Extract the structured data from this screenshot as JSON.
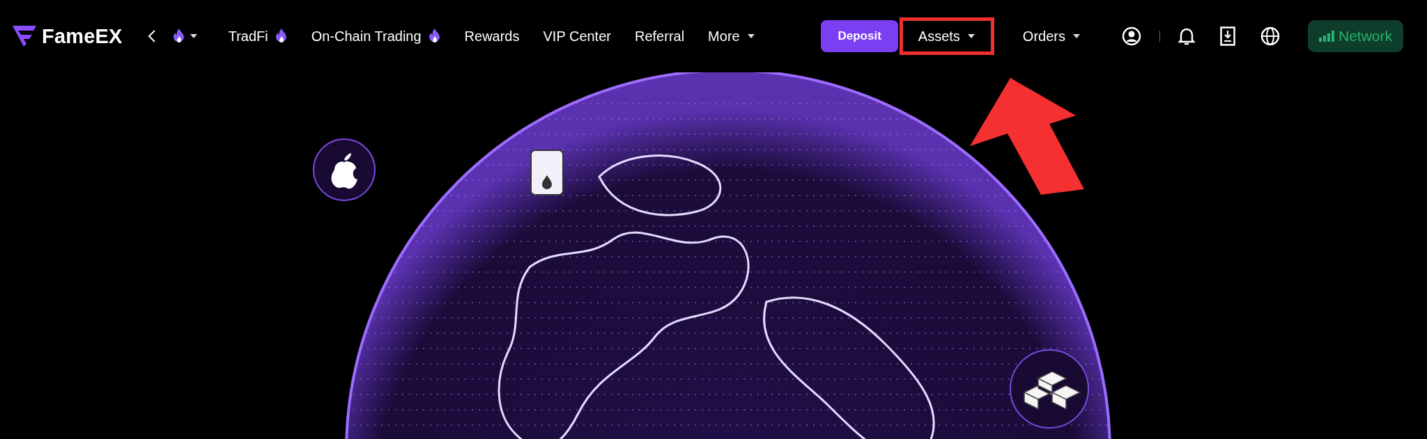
{
  "brand": {
    "name": "FameEX"
  },
  "nav_left": [
    {
      "kind": "back"
    },
    {
      "kind": "hot-dropdown",
      "hot": true,
      "dropdown": true
    },
    {
      "kind": "link",
      "label": "TradFi",
      "hot": true,
      "dropdown": false
    },
    {
      "kind": "link",
      "label": "On-Chain Trading",
      "hot": true,
      "dropdown": false
    },
    {
      "kind": "link",
      "label": "Rewards",
      "hot": false,
      "dropdown": false
    },
    {
      "kind": "link",
      "label": "VIP Center",
      "hot": false,
      "dropdown": false
    },
    {
      "kind": "link",
      "label": "Referral",
      "hot": false,
      "dropdown": false
    },
    {
      "kind": "link",
      "label": "More",
      "hot": false,
      "dropdown": true
    }
  ],
  "deposit_button": {
    "label": "Deposit"
  },
  "menus": [
    {
      "label": "Assets",
      "highlighted": true
    },
    {
      "label": "Orders",
      "highlighted": false
    }
  ],
  "network_button": {
    "label": "Network"
  }
}
